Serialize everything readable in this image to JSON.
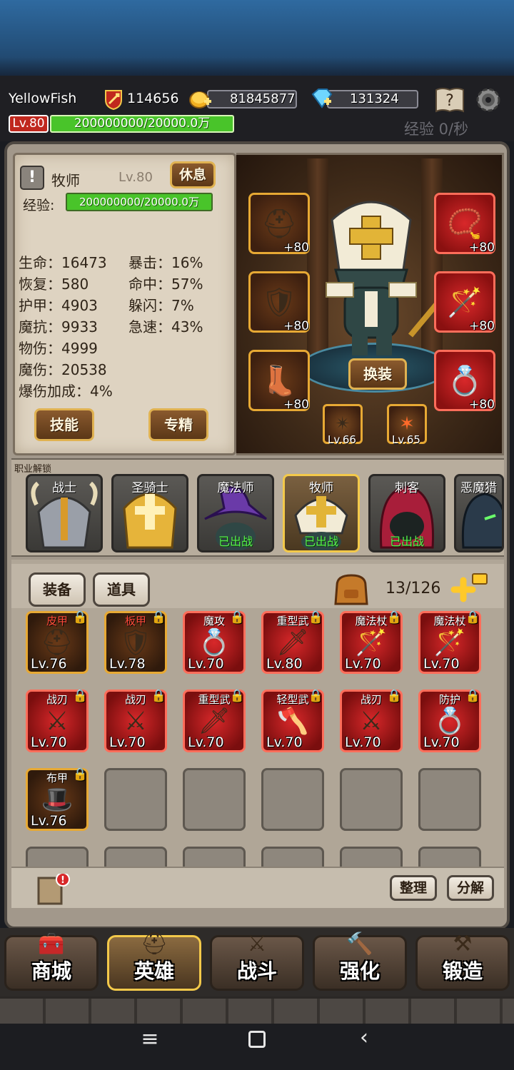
{
  "header": {
    "player_name": "YellowFish",
    "power": "114656",
    "gold": "81845877",
    "gems": "131324",
    "level_badge": "Lv.80",
    "xp_text": "200000000/20000.0万",
    "xp_rate": "经验 0/秒"
  },
  "hero_panel": {
    "class_name": "牧师",
    "class_level": "Lv.80",
    "rest_label": "休息",
    "xp_label": "经验:",
    "xp_text": "200000000/20000.0万",
    "stats_left": [
      {
        "label": "生命",
        "value": "16473"
      },
      {
        "label": "恢复",
        "value": "580"
      },
      {
        "label": "护甲",
        "value": "4903"
      },
      {
        "label": "魔抗",
        "value": "9933"
      },
      {
        "label": "物伤",
        "value": "4999"
      },
      {
        "label": "魔伤",
        "value": "20538"
      },
      {
        "label": "爆伤加成",
        "value": "4%"
      }
    ],
    "stats_right": [
      {
        "label": "暴击",
        "value": "16%"
      },
      {
        "label": "命中",
        "value": "57%"
      },
      {
        "label": "躲闪",
        "value": "7%"
      },
      {
        "label": "急速",
        "value": "43%"
      }
    ],
    "skills_label": "技能",
    "mastery_label": "专精"
  },
  "stage": {
    "change_gear_label": "换装",
    "gear_left": [
      "+80",
      "+80",
      "+80"
    ],
    "gear_right": [
      "+80",
      "+80",
      "+80"
    ],
    "runes": [
      "Lv.66",
      "Lv.65"
    ]
  },
  "classes": {
    "title": "职业解锁",
    "items": [
      {
        "name": "战士",
        "status": ""
      },
      {
        "name": "圣骑士",
        "status": ""
      },
      {
        "name": "魔法师",
        "status": "已出战"
      },
      {
        "name": "牧师",
        "status": "已出战"
      },
      {
        "name": "刺客",
        "status": "已出战"
      },
      {
        "name": "恶魔猎",
        "status": ""
      }
    ]
  },
  "inventory": {
    "tab_equipment": "装备",
    "tab_items": "道具",
    "capacity": "13/126",
    "items": [
      {
        "name": "皮甲",
        "level": "Lv.76",
        "rarity": "gold",
        "art": "⛑"
      },
      {
        "name": "板甲",
        "level": "Lv.78",
        "rarity": "gold",
        "art": "🛡"
      },
      {
        "name": "魔攻",
        "level": "Lv.70",
        "rarity": "red",
        "art": "💍"
      },
      {
        "name": "重型武",
        "level": "Lv.80",
        "rarity": "red",
        "art": "🗡"
      },
      {
        "name": "魔法杖",
        "level": "Lv.70",
        "rarity": "red",
        "art": "🪄"
      },
      {
        "name": "魔法杖",
        "level": "Lv.70",
        "rarity": "red",
        "art": "🪄"
      },
      {
        "name": "战刃",
        "level": "Lv.70",
        "rarity": "red",
        "art": "⚔"
      },
      {
        "name": "战刃",
        "level": "Lv.70",
        "rarity": "red",
        "art": "⚔"
      },
      {
        "name": "重型武",
        "level": "Lv.70",
        "rarity": "red",
        "art": "🗡"
      },
      {
        "name": "轻型武",
        "level": "Lv.70",
        "rarity": "red",
        "art": "🪓"
      },
      {
        "name": "战刃",
        "level": "Lv.70",
        "rarity": "red",
        "art": "⚔"
      },
      {
        "name": "防护",
        "level": "Lv.70",
        "rarity": "red",
        "art": "💍"
      },
      {
        "name": "布甲",
        "level": "Lv.76",
        "rarity": "gold",
        "art": "🎩"
      }
    ],
    "sort_label": "整理",
    "decompose_label": "分解"
  },
  "nav": {
    "items": [
      "商城",
      "英雄",
      "战斗",
      "强化",
      "锻造"
    ],
    "active": "英雄"
  },
  "colors": {
    "xp_green": "#49c42a",
    "level_red": "#c0281e",
    "deploy_green": "#58f04e",
    "legendary_red": "#d8282a",
    "epic_gold": "#e7a934"
  }
}
